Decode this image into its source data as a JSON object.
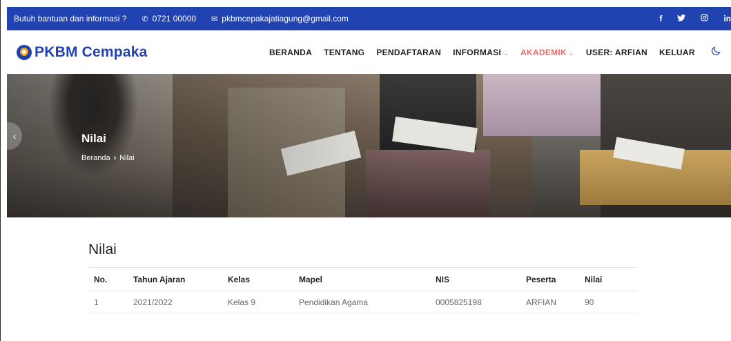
{
  "topbar": {
    "help_text": "Butuh bantuan dan informasi ?",
    "phone_icon": "phone-icon",
    "phone": "0721 00000",
    "email_icon": "envelope-icon",
    "email": "pkbmcepakajatiagung@gmail.com",
    "social": [
      {
        "icon": "facebook-icon",
        "glyph": "f"
      },
      {
        "icon": "twitter-icon",
        "glyph": "🐦"
      },
      {
        "icon": "instagram-icon",
        "glyph": "◎"
      },
      {
        "icon": "linkedin-icon",
        "glyph": "in"
      }
    ],
    "color": "#2143b1"
  },
  "brand": {
    "name": "PKBM Cempaka",
    "logo_icon": "brand-logo-icon"
  },
  "nav": {
    "items": [
      {
        "label": "BERANDA",
        "dropdown": false
      },
      {
        "label": "TENTANG",
        "dropdown": false
      },
      {
        "label": "PENDAFTARAN",
        "dropdown": false
      },
      {
        "label": "INFORMASI",
        "dropdown": true
      },
      {
        "label": "AKADEMIK",
        "dropdown": true,
        "active": true
      },
      {
        "label": "USER: ARFIAN",
        "dropdown": false
      },
      {
        "label": "KELUAR",
        "dropdown": false
      }
    ],
    "theme_toggle_icon": "moon-icon",
    "active_color": "#ef6b6b"
  },
  "hero": {
    "title": "Nilai",
    "breadcrumb": {
      "home": "Beranda",
      "separator": "›",
      "current": "Nilai"
    }
  },
  "content": {
    "title": "Nilai",
    "table": {
      "headers": [
        "No.",
        "Tahun Ajaran",
        "Kelas",
        "Mapel",
        "NIS",
        "Peserta",
        "Nilai"
      ],
      "rows": [
        [
          "1",
          "2021/2022",
          "Kelas 9",
          "Pendidikan Agama",
          "0005825198",
          "ARFIAN",
          "90"
        ]
      ]
    }
  }
}
